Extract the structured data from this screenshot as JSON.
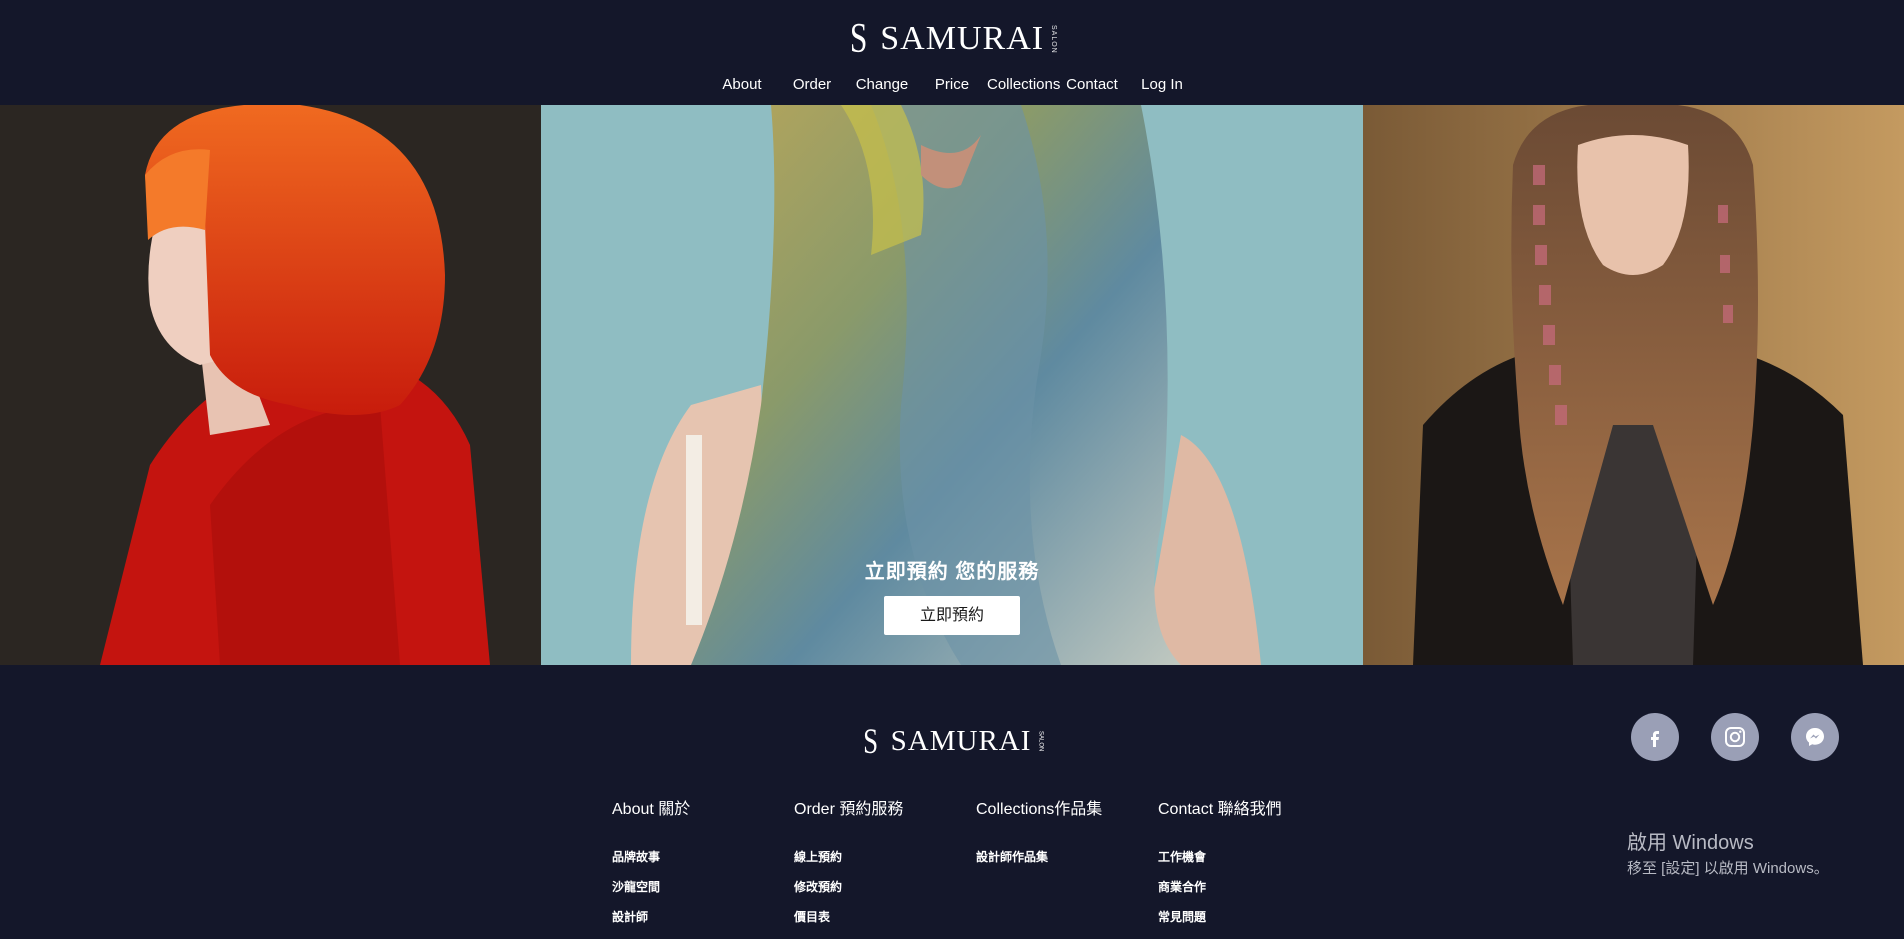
{
  "header": {
    "brand": "SAMURAI",
    "brand_mark": "S",
    "brand_sub": "SALON",
    "nav": [
      {
        "label": "About"
      },
      {
        "label": "Order"
      },
      {
        "label": "Change"
      },
      {
        "label": "Price"
      },
      {
        "label": "Collections"
      },
      {
        "label": "Contact"
      },
      {
        "label": "Log In"
      }
    ]
  },
  "hero": {
    "headline": "立即預約 您的服務",
    "cta_label": "立即預約"
  },
  "footer": {
    "brand": "SAMURAI",
    "brand_mark": "S",
    "brand_sub": "SALON",
    "social": [
      {
        "icon": "facebook-icon"
      },
      {
        "icon": "instagram-icon"
      },
      {
        "icon": "messenger-icon"
      }
    ],
    "columns": [
      {
        "title": "About 關於",
        "items": [
          "品牌故事",
          "沙龍空間",
          "設計師"
        ]
      },
      {
        "title": "Order 預約服務",
        "items": [
          "線上預約",
          "修改預約",
          "價目表"
        ]
      },
      {
        "title": "Collections作品集",
        "items": [
          "設計師作品集"
        ]
      },
      {
        "title": "Contact 聯絡我們",
        "items": [
          "工作機會",
          "商業合作",
          "常見問題"
        ]
      }
    ]
  },
  "windows_watermark": {
    "line1": "啟用 Windows",
    "line2": "移至 [設定] 以啟用 Windows。"
  },
  "colors": {
    "background": "#14172a",
    "social_circle": "#9a9fb6"
  }
}
